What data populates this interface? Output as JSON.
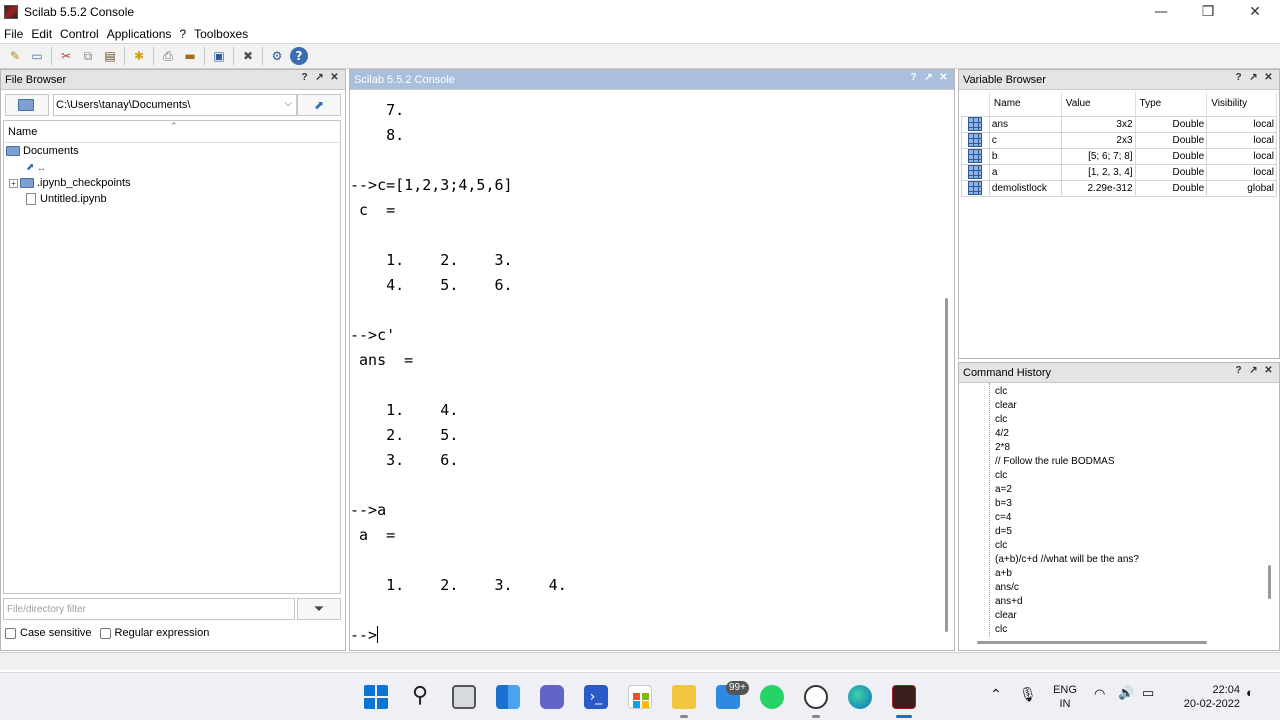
{
  "window": {
    "title": "Scilab 5.5.2 Console"
  },
  "menu": [
    "File",
    "Edit",
    "Control",
    "Applications",
    "?",
    "Toolboxes"
  ],
  "file_browser": {
    "title": "File Browser",
    "path": "C:\\Users\\tanay\\Documents\\",
    "column_name": "Name",
    "tree": {
      "root": "Documents",
      "parent": "..",
      "folder": ".ipynb_checkpoints",
      "file": "Untitled.ipynb"
    },
    "filter_placeholder": "File/directory filter",
    "case_sensitive_label": "Case sensitive",
    "regex_label": "Regular expression"
  },
  "console": {
    "title": "Scilab 5.5.2 Console",
    "lines": [
      "    7.",
      "    8.",
      "",
      "-->c=[1,2,3;4,5,6]",
      " c  =",
      "",
      "    1.    2.    3.",
      "    4.    5.    6.",
      "",
      "-->c'",
      " ans  =",
      "",
      "    1.    4.",
      "    2.    5.",
      "    3.    6.",
      "",
      "-->a",
      " a  =",
      "",
      "    1.    2.    3.    4."
    ],
    "prompt": "-->"
  },
  "variable_browser": {
    "title": "Variable Browser",
    "columns": [
      "Name",
      "Value",
      "Type",
      "Visibility"
    ],
    "rows": [
      {
        "name": "ans",
        "value": "3x2",
        "type": "Double",
        "visibility": "local"
      },
      {
        "name": "c",
        "value": "2x3",
        "type": "Double",
        "visibility": "local"
      },
      {
        "name": "b",
        "value": "[5; 6; 7; 8]",
        "type": "Double",
        "visibility": "local"
      },
      {
        "name": "a",
        "value": "[1, 2, 3, 4]",
        "type": "Double",
        "visibility": "local"
      },
      {
        "name": "demolistlock",
        "value": "2.29e-312",
        "type": "Double",
        "visibility": "global"
      }
    ]
  },
  "command_history": {
    "title": "Command History",
    "items": [
      "clc",
      "clear",
      "clc",
      "4/2",
      "2*8",
      "// Follow the rule BODMAS",
      "clc",
      "a=2",
      "b=3",
      "c=4",
      "d=5",
      "clc",
      "(a+b)/c+d //what will be the ans?",
      "a+b",
      "ans/c",
      "ans+d",
      "clear",
      "clc"
    ]
  },
  "panel_buttons": [
    "?",
    "↗",
    "✕"
  ],
  "taskbar": {
    "badge": "99+",
    "lang_top": "ENG",
    "lang_bottom": "IN",
    "time": "22:04",
    "date": "20-02-2022"
  }
}
